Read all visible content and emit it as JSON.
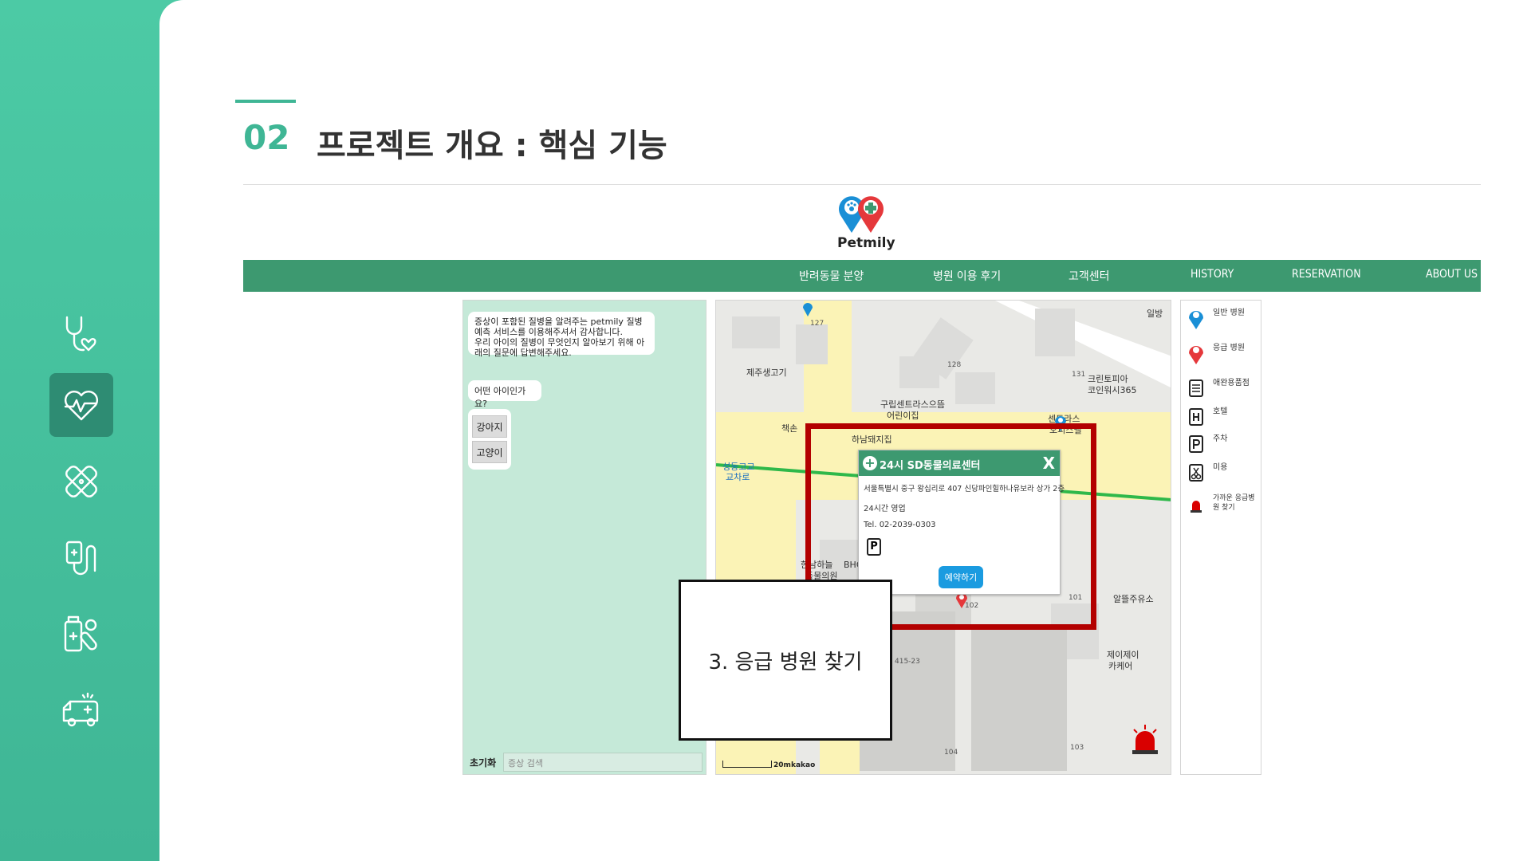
{
  "slide": {
    "number": "02",
    "title": "프로젝트 개요 : 핵심 기능"
  },
  "sidebar": {
    "icons": [
      "stethoscope-icon",
      "heart-pulse-icon",
      "bandage-icon",
      "iv-drip-icon",
      "medicine-icon",
      "ambulance-icon"
    ],
    "active_index": 1
  },
  "site": {
    "logo_text": "Petmily",
    "nav": [
      "반려동물 분양",
      "병원 이용 후기",
      "고객센터",
      "HISTORY",
      "RESERVATION",
      "ABOUT US"
    ],
    "accent": "#3d9970"
  },
  "chat": {
    "intro": "증상이 포함된 질병을 알려주는 petmily 질병 예측 서비스를 이용해주셔서 감사합니다.\n우리 아이의 질병이 무엇인지 알아보기 위해 아래의 질문에 답변해주세요.",
    "question": "어떤 아이인가요?",
    "choices": [
      "강아지",
      "고양이"
    ],
    "reset_label": "초기화",
    "search_placeholder": "증상 검색"
  },
  "map": {
    "labels": [
      "제주생고기",
      "구립센트라스으뜸",
      "어린이집",
      "하남돼지집",
      "크린토피아",
      "코인워시365",
      "센트라스",
      "오피스텔",
      "성동고교",
      "교차로",
      "알뜰주유소",
      "제이제이",
      "카케어",
      "책손",
      "한남하늘",
      "동물의원",
      "BHC",
      "일방"
    ],
    "numbers": [
      "127",
      "128",
      "131",
      "101",
      "103",
      "104",
      "102",
      "415-23"
    ],
    "scale_text": "20m",
    "provider": "kakao"
  },
  "popup": {
    "title": "24시 SD동물의료센터",
    "close": "X",
    "address": "서울특별시 중구 왕십리로 407 신당파인힐하나유보라 상가 2층",
    "hours": "24시간 영업",
    "phone": "Tel. 02-2039-0303",
    "parking_icon": "P",
    "reserve_label": "예약하기"
  },
  "legend": [
    {
      "icon": "blue-pin-icon",
      "label": "일반 병원"
    },
    {
      "icon": "red-pin-icon",
      "label": "응급 병원"
    },
    {
      "icon": "pet-shop-icon",
      "label": "애완용품점"
    },
    {
      "icon": "hotel-icon",
      "label": "호텔"
    },
    {
      "icon": "parking-icon",
      "label": "주차"
    },
    {
      "icon": "grooming-icon",
      "label": "미용"
    },
    {
      "icon": "siren-icon",
      "label": "가까운 응급병원 찾기"
    }
  ],
  "callout": "3. 응급 병원 찾기"
}
